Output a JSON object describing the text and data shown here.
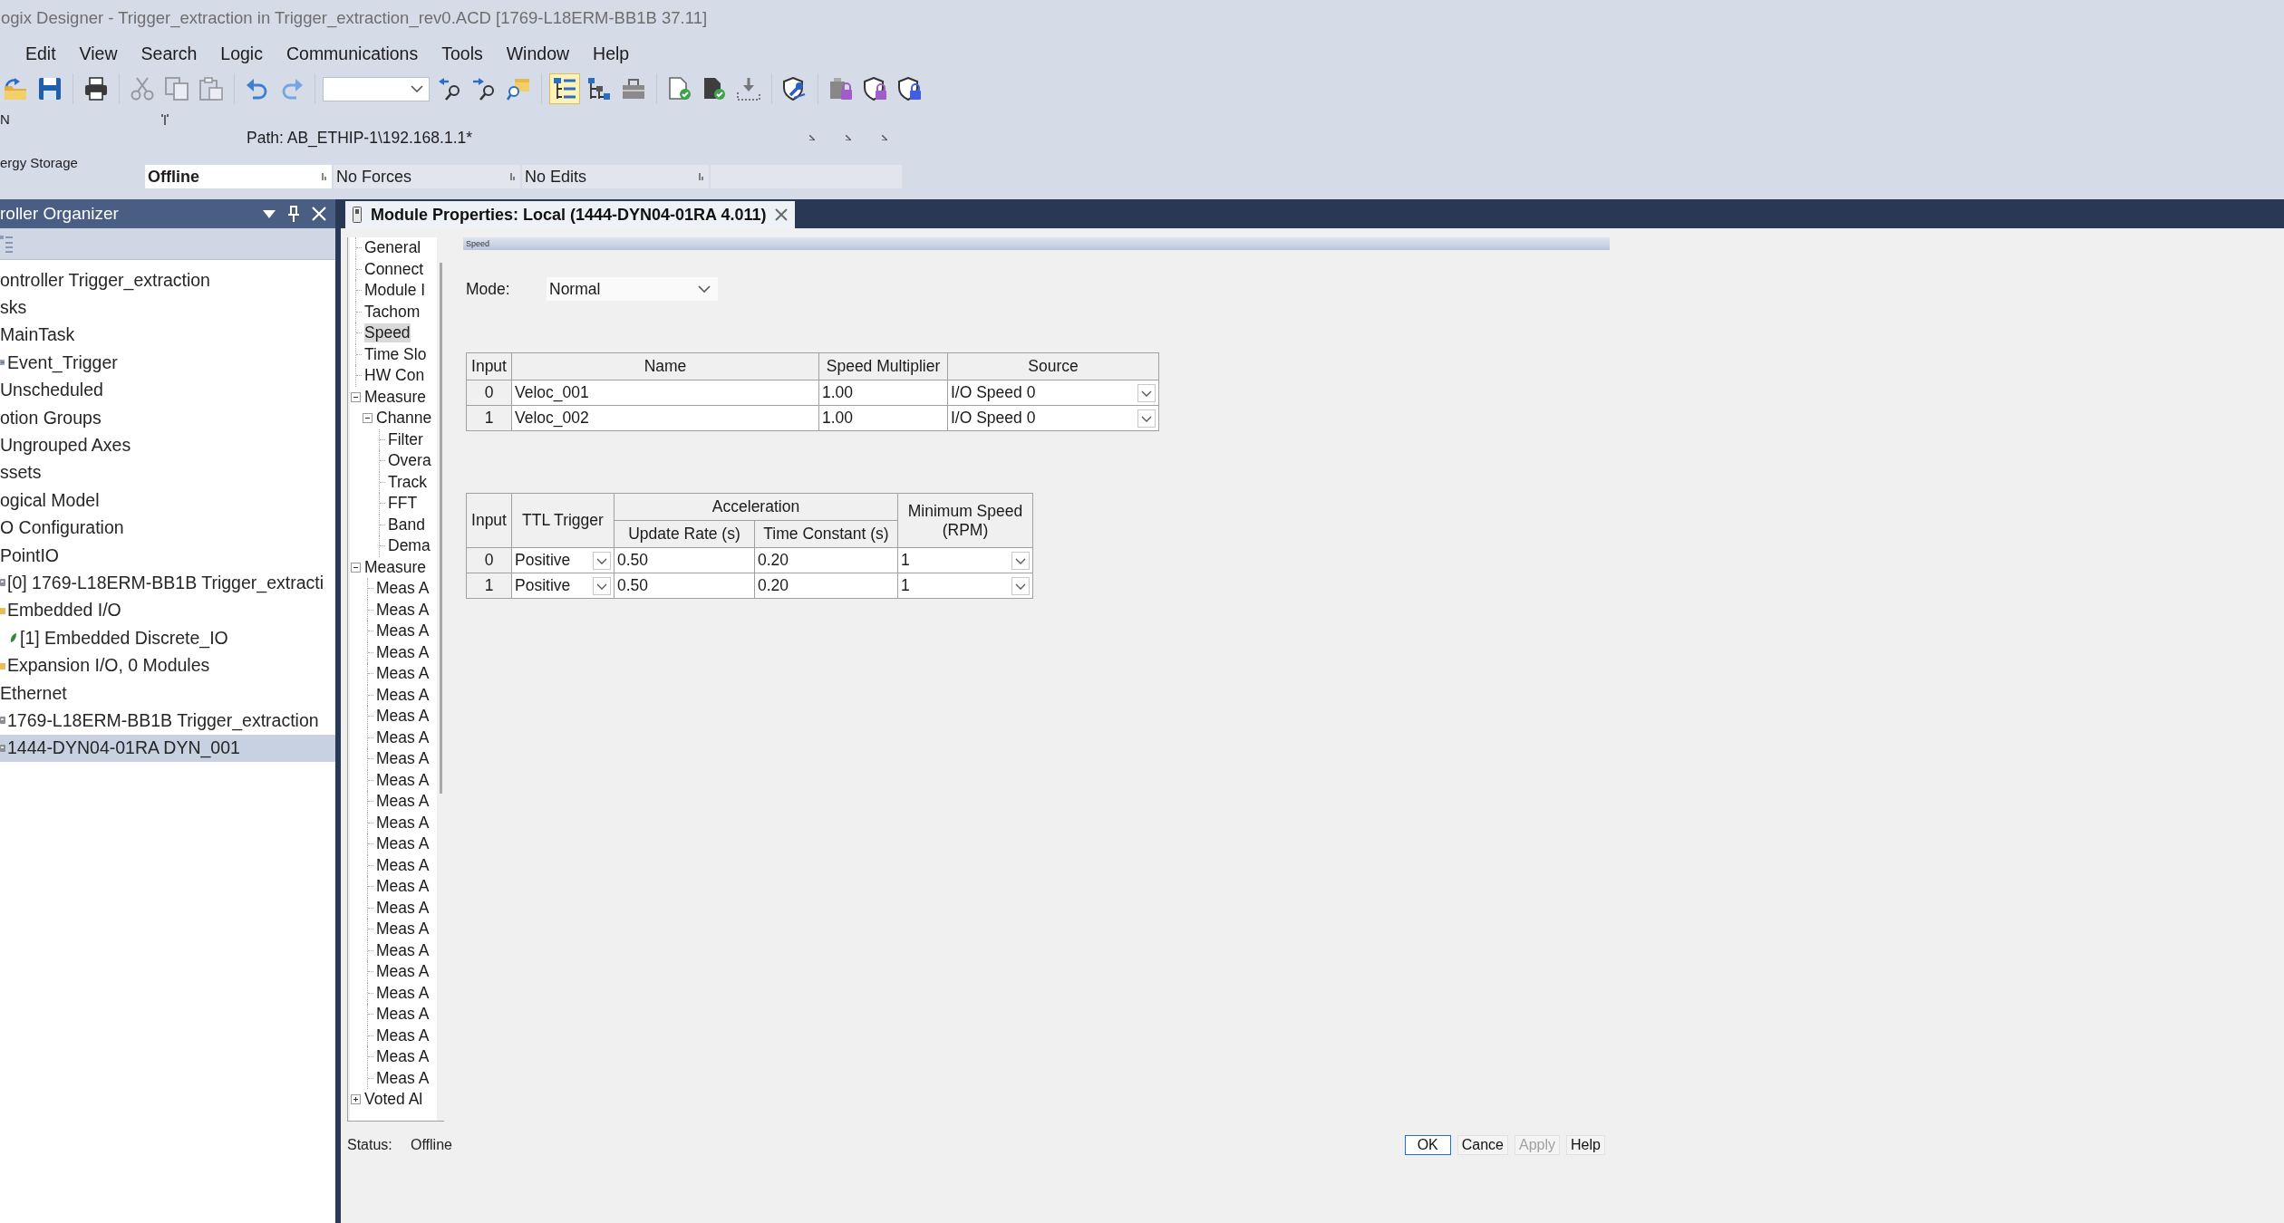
{
  "window": {
    "title": "ogix Designer - Trigger_extraction in Trigger_extraction_rev0.ACD [1769-L18ERM-BB1B 37.11]"
  },
  "menu": [
    "Edit",
    "View",
    "Search",
    "Logic",
    "Communications",
    "Tools",
    "Window",
    "Help"
  ],
  "toolbar": {
    "groups": [
      [
        {
          "kind": "button",
          "disabled": false,
          "on": false
        },
        {
          "kind": "button",
          "disabled": false,
          "on": false
        }
      ],
      [
        {
          "kind": "button",
          "disabled": false,
          "on": false
        }
      ],
      [
        {
          "kind": "button",
          "disabled": true,
          "on": false
        },
        {
          "kind": "button",
          "disabled": true,
          "on": false
        },
        {
          "kind": "button",
          "disabled": true,
          "on": false
        }
      ],
      [
        {
          "kind": "button",
          "disabled": false,
          "on": false
        },
        {
          "kind": "button",
          "disabled": false,
          "on": false
        }
      ],
      [
        {
          "kind": "combo",
          "disabled": false,
          "on": false
        },
        {
          "kind": "button",
          "disabled": false,
          "on": false
        },
        {
          "kind": "button",
          "disabled": false,
          "on": false
        },
        {
          "kind": "button",
          "disabled": false,
          "on": false
        }
      ],
      [
        {
          "kind": "button",
          "disabled": false,
          "on": true
        },
        {
          "kind": "button",
          "disabled": false,
          "on": false
        },
        {
          "kind": "button",
          "disabled": false,
          "on": false
        }
      ],
      [
        {
          "kind": "button",
          "disabled": false,
          "on": false
        },
        {
          "kind": "button",
          "disabled": false,
          "on": false
        },
        {
          "kind": "button",
          "disabled": false,
          "on": false
        }
      ],
      [
        {
          "kind": "button",
          "disabled": false,
          "on": false
        }
      ],
      [
        {
          "kind": "button",
          "disabled": false,
          "on": false
        },
        {
          "kind": "button",
          "disabled": false,
          "on": false
        },
        {
          "kind": "button",
          "disabled": false,
          "on": false
        }
      ]
    ]
  },
  "controller": {
    "mode_lines": [
      "N",
      "ergy Storage"
    ],
    "path": "Path: AB_ETHIP-1\\192.168.1.1*",
    "status": [
      {
        "kind": "mode",
        "text": "Offline"
      },
      {
        "kind": "plain",
        "text": "No Forces"
      },
      {
        "kind": "plain",
        "text": "No Edits"
      }
    ]
  },
  "organizer": {
    "title": "roller Organizer",
    "tree": [
      {
        "kind": "text",
        "label": "ontroller Trigger_extraction",
        "selected": false
      },
      {
        "kind": "text",
        "label": "sks",
        "selected": false
      },
      {
        "kind": "text",
        "label": "MainTask",
        "selected": false
      },
      {
        "kind": "task",
        "label": "Event_Trigger",
        "selected": false
      },
      {
        "kind": "text",
        "label": "Unscheduled",
        "selected": false
      },
      {
        "kind": "text",
        "label": "otion Groups",
        "selected": false
      },
      {
        "kind": "text",
        "label": "Ungrouped Axes",
        "selected": false
      },
      {
        "kind": "text",
        "label": "ssets",
        "selected": false
      },
      {
        "kind": "text",
        "label": "ogical Model",
        "selected": false
      },
      {
        "kind": "text",
        "label": "O Configuration",
        "selected": false
      },
      {
        "kind": "text",
        "label": "PointIO",
        "selected": false
      },
      {
        "kind": "module",
        "label": "[0] 1769-L18ERM-BB1B Trigger_extracti",
        "selected": false
      },
      {
        "kind": "folder",
        "label": "Embedded I/O",
        "selected": false,
        "children": [
          {
            "kind": "io",
            "label": "[1] Embedded Discrete_IO",
            "selected": false
          }
        ]
      },
      {
        "kind": "folder",
        "label": "Expansion I/O, 0 Modules",
        "selected": false
      },
      {
        "kind": "text",
        "label": "Ethernet",
        "selected": false
      },
      {
        "kind": "module",
        "label": "1769-L18ERM-BB1B Trigger_extraction",
        "selected": false
      },
      {
        "kind": "module",
        "label": "1444-DYN04-01RA DYN_001",
        "selected": true
      }
    ]
  },
  "document_tab": {
    "title": "Module Properties: Local (1444-DYN04-01RA 4.011)"
  },
  "dialog": {
    "categories": [
      {
        "kind": "page",
        "label": "General",
        "selected": false
      },
      {
        "kind": "page",
        "label": "Connect",
        "selected": false
      },
      {
        "kind": "page",
        "label": "Module I",
        "selected": false
      },
      {
        "kind": "page",
        "label": "Tachom",
        "selected": false
      },
      {
        "kind": "page",
        "label": "Speed",
        "selected": true
      },
      {
        "kind": "page",
        "label": "Time Slo",
        "selected": false
      },
      {
        "kind": "page",
        "label": "HW Con",
        "selected": false
      },
      {
        "kind": "group",
        "label": "Measure",
        "selected": false,
        "expanded": true,
        "children": [
          {
            "kind": "group",
            "label": "Channe",
            "selected": false,
            "expanded": true,
            "children": [
              {
                "kind": "page",
                "label": "Filter",
                "selected": false
              },
              {
                "kind": "page",
                "label": "Overa",
                "selected": false
              },
              {
                "kind": "page",
                "label": "Track",
                "selected": false
              },
              {
                "kind": "page",
                "label": "FFT",
                "selected": false
              },
              {
                "kind": "page",
                "label": "Band",
                "selected": false
              },
              {
                "kind": "page",
                "label": "Dema",
                "selected": false
              }
            ]
          }
        ]
      },
      {
        "kind": "group",
        "label": "Measure",
        "selected": false,
        "expanded": true,
        "children": [
          {
            "kind": "page",
            "label": "Meas A",
            "selected": false
          },
          {
            "kind": "page",
            "label": "Meas A",
            "selected": false
          },
          {
            "kind": "page",
            "label": "Meas A",
            "selected": false
          },
          {
            "kind": "page",
            "label": "Meas A",
            "selected": false
          },
          {
            "kind": "page",
            "label": "Meas A",
            "selected": false
          },
          {
            "kind": "page",
            "label": "Meas A",
            "selected": false
          },
          {
            "kind": "page",
            "label": "Meas A",
            "selected": false
          },
          {
            "kind": "page",
            "label": "Meas A",
            "selected": false
          },
          {
            "kind": "page",
            "label": "Meas A",
            "selected": false
          },
          {
            "kind": "page",
            "label": "Meas A",
            "selected": false
          },
          {
            "kind": "page",
            "label": "Meas A",
            "selected": false
          },
          {
            "kind": "page",
            "label": "Meas A",
            "selected": false
          },
          {
            "kind": "page",
            "label": "Meas A",
            "selected": false
          },
          {
            "kind": "page",
            "label": "Meas A",
            "selected": false
          },
          {
            "kind": "page",
            "label": "Meas A",
            "selected": false
          },
          {
            "kind": "page",
            "label": "Meas A",
            "selected": false
          },
          {
            "kind": "page",
            "label": "Meas A",
            "selected": false
          },
          {
            "kind": "page",
            "label": "Meas A",
            "selected": false
          },
          {
            "kind": "page",
            "label": "Meas A",
            "selected": false
          },
          {
            "kind": "page",
            "label": "Meas A",
            "selected": false
          },
          {
            "kind": "page",
            "label": "Meas A",
            "selected": false
          },
          {
            "kind": "page",
            "label": "Meas A",
            "selected": false
          },
          {
            "kind": "page",
            "label": "Meas A",
            "selected": false
          },
          {
            "kind": "page",
            "label": "Meas A",
            "selected": false
          }
        ]
      },
      {
        "kind": "group",
        "label": "Voted Al",
        "selected": false,
        "expanded": false
      }
    ],
    "page_title": "Speed",
    "mode": {
      "label": "Mode:",
      "value": "Normal"
    },
    "speed_table": {
      "columns": [
        "Input",
        "Name",
        "Speed Multiplier",
        "Source"
      ],
      "rows": [
        {
          "input": "0",
          "name": "Veloc_001",
          "multiplier": "1.00",
          "source": "I/O Speed 0"
        },
        {
          "input": "1",
          "name": "Veloc_002",
          "multiplier": "1.00",
          "source": "I/O Speed 0"
        }
      ]
    },
    "trigger_table": {
      "headers": {
        "input": "Input",
        "ttl_trigger": "TTL Trigger",
        "acceleration": "Acceleration",
        "update_rate": "Update Rate (s)",
        "time_constant": "Time Constant (s)",
        "min_speed": "Minimum Speed (RPM)"
      },
      "rows": [
        {
          "input": "0",
          "ttl_trigger": "Positive",
          "update_rate": "0.50",
          "time_constant": "0.20",
          "min_speed": "1"
        },
        {
          "input": "1",
          "ttl_trigger": "Positive",
          "update_rate": "0.50",
          "time_constant": "0.20",
          "min_speed": "1"
        }
      ]
    },
    "status": {
      "label": "Status:",
      "value": "Offline"
    },
    "buttons": [
      {
        "label": "OK",
        "default": true,
        "disabled": false
      },
      {
        "label": "Cance",
        "default": false,
        "disabled": false
      },
      {
        "label": "Apply",
        "default": false,
        "disabled": true
      },
      {
        "label": "Help",
        "default": false,
        "disabled": false
      }
    ]
  }
}
